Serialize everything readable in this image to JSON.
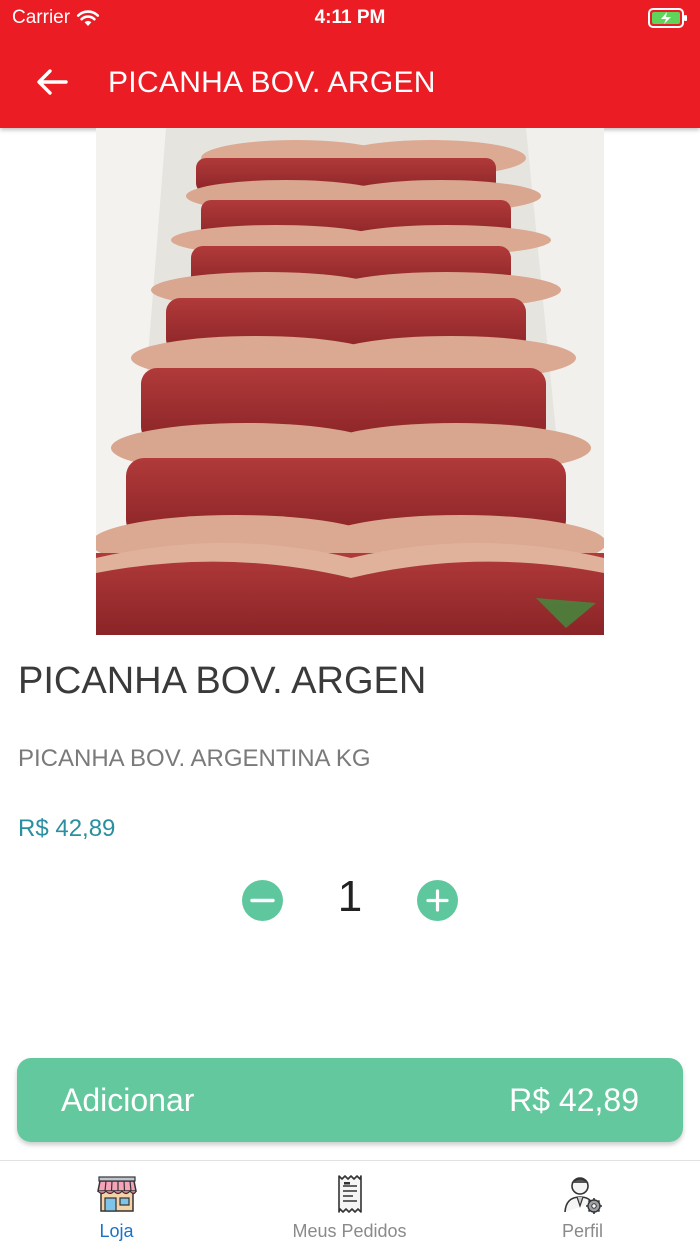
{
  "status_bar": {
    "carrier": "Carrier",
    "time": "4:11 PM"
  },
  "app_bar": {
    "title": "PICANHA BOV. ARGEN",
    "back_icon": "arrow-left-icon"
  },
  "product": {
    "name": "PICANHA BOV. ARGEN",
    "description": "PICANHA BOV. ARGENTINA KG",
    "price": "R$ 42,89",
    "quantity": "1"
  },
  "add_button": {
    "label": "Adicionar",
    "total": "R$ 42,89"
  },
  "tabs": [
    {
      "label": "Loja",
      "icon": "store-icon",
      "active": true
    },
    {
      "label": "Meus Pedidos",
      "icon": "receipt-icon",
      "active": false
    },
    {
      "label": "Perfil",
      "icon": "user-settings-icon",
      "active": false
    }
  ],
  "colors": {
    "header": "#ec1c24",
    "accent_green": "#63c89d",
    "price": "#2a8fa0",
    "tab_active": "#1a73c9"
  }
}
